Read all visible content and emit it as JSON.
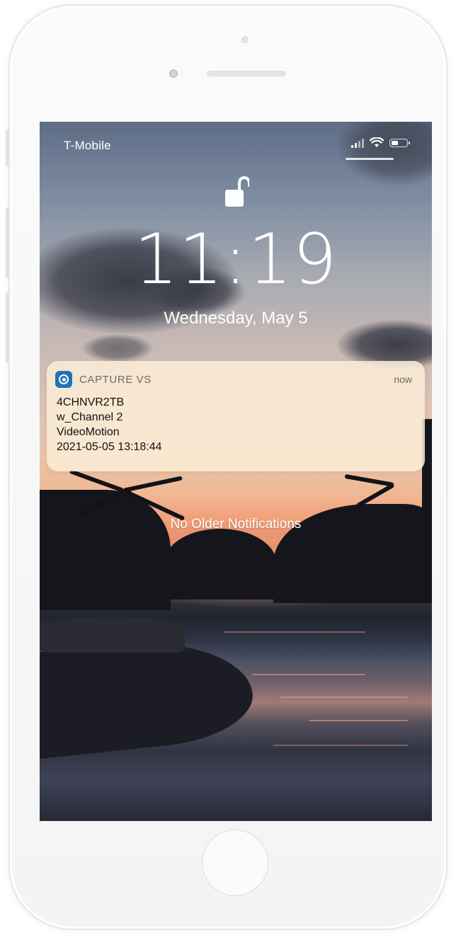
{
  "status_bar": {
    "carrier": "T-Mobile",
    "signal_bars": 4,
    "signal_bars_filled": 2,
    "wifi_icon": "wifi-icon",
    "battery_icon": "battery-icon"
  },
  "lock_screen": {
    "lock_icon": "unlocked-padlock-icon",
    "time": "11:19",
    "date": "Wednesday, May 5"
  },
  "notification": {
    "app_icon": "capture-vs-app-icon",
    "app_name": "CAPTURE VS",
    "time": "now",
    "lines": [
      "4CHNVR2TB",
      "w_Channel 2",
      "VideoMotion",
      "2021-05-05 13:18:44"
    ]
  },
  "footer": {
    "no_older_text": "No Older Notifications"
  },
  "colors": {
    "notification_bg": "#FCECD6",
    "app_icon_blue": "#1F73B7",
    "text_white": "#FFFFFF"
  }
}
